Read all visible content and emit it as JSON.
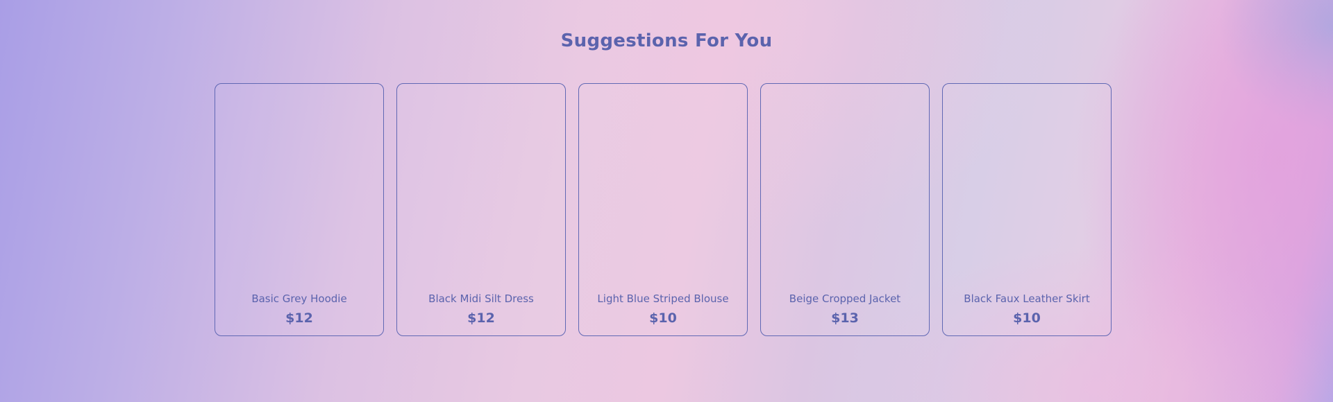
{
  "heading": "Suggestions For You",
  "products": [
    {
      "name": "Basic Grey Hoodie",
      "price": "$12"
    },
    {
      "name": "Black Midi Silt Dress",
      "price": "$12"
    },
    {
      "name": "Light Blue Striped Blouse",
      "price": "$10"
    },
    {
      "name": "Beige Cropped Jacket",
      "price": "$13"
    },
    {
      "name": "Black Faux Leather Skirt",
      "price": "$10"
    }
  ],
  "colors": {
    "accent": "#5b63ad",
    "card_border": "#6068b4"
  }
}
